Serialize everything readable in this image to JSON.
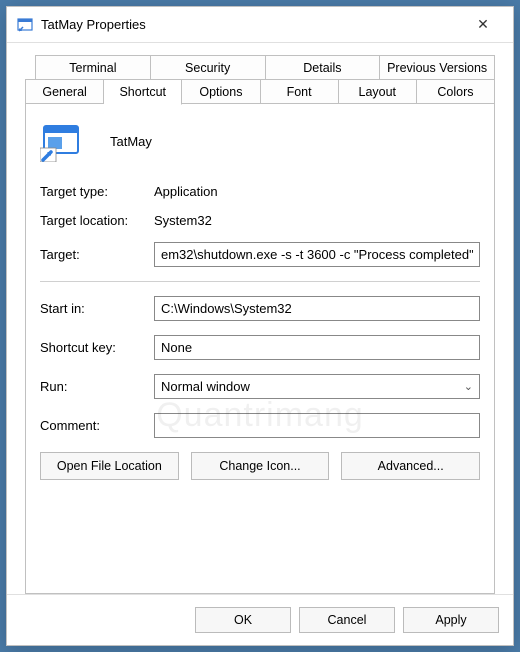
{
  "window": {
    "title": "TatMay Properties"
  },
  "tabs": {
    "row1": [
      "Terminal",
      "Security",
      "Details",
      "Previous Versions"
    ],
    "row2": [
      "General",
      "Shortcut",
      "Options",
      "Font",
      "Layout",
      "Colors"
    ],
    "active": "Shortcut"
  },
  "shortcut": {
    "name": "TatMay",
    "target_type_label": "Target type:",
    "target_type": "Application",
    "target_location_label": "Target location:",
    "target_location": "System32",
    "target_label": "Target:",
    "target": "em32\\shutdown.exe -s -t 3600 -c \"Process completed\"",
    "start_in_label": "Start in:",
    "start_in": "C:\\Windows\\System32",
    "shortcut_key_label": "Shortcut key:",
    "shortcut_key": "None",
    "run_label": "Run:",
    "run": "Normal window",
    "comment_label": "Comment:",
    "comment": ""
  },
  "buttons": {
    "open_file_location": "Open File Location",
    "change_icon": "Change Icon...",
    "advanced": "Advanced...",
    "ok": "OK",
    "cancel": "Cancel",
    "apply": "Apply"
  },
  "watermark": "Quantrimang"
}
